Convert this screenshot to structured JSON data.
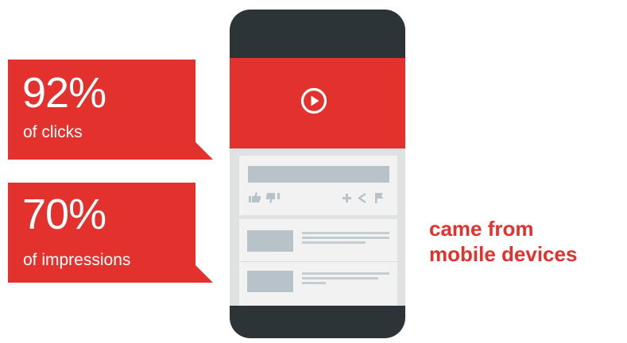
{
  "stats": [
    {
      "value": "92%",
      "label": "of clicks"
    },
    {
      "value": "70%",
      "label": "of impressions"
    }
  ],
  "caption": {
    "line1": "came from",
    "line2": "mobile devices"
  },
  "colors": {
    "accent": "#e3312d",
    "phone_body": "#2d3438",
    "screen_bg": "#e0e2e2",
    "card_bg": "#f2f2f2",
    "placeholder": "#b8c3c9"
  },
  "icons": [
    "play-circle-icon",
    "thumbs-up-icon",
    "thumbs-down-icon",
    "plus-icon",
    "share-icon",
    "flag-icon"
  ]
}
